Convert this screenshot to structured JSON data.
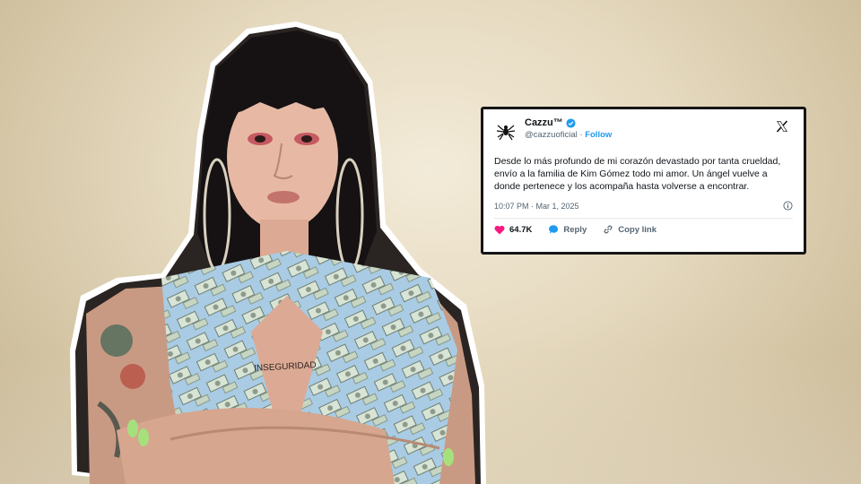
{
  "tweet": {
    "display_name": "Cazzu™",
    "handle": "@cazzuoficial",
    "separator": "·",
    "follow_label": "Follow",
    "body": "Desde lo más profundo de mi corazón devastado por tanta crueldad, envío a la familia de Kim Gómez todo mi amor. Un ángel vuelve a donde pertenece y los acompaña hasta volverse a encontrar.",
    "timestamp": "10:07 PM · Mar 1, 2025",
    "likes": "64.7K",
    "reply_label": "Reply",
    "copy_label": "Copy link"
  },
  "photo": {
    "subject": "woman with black bangs, hoop earrings, arms crossed, wearing money-print top",
    "tattoo_text": "INSEGURIDAD"
  },
  "colors": {
    "background": "#e6dac0",
    "accent_blue": "#1d9bf0",
    "like_pink": "#f91880",
    "tweet_border": "#151515"
  }
}
